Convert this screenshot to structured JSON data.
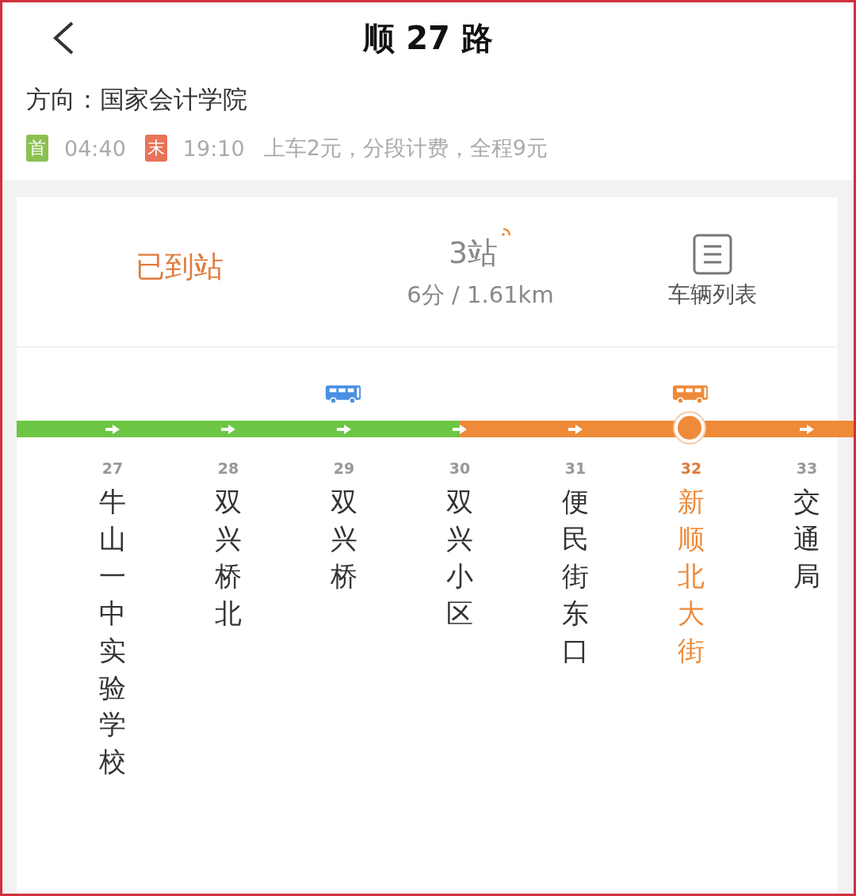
{
  "header": {
    "title": "顺 27 路"
  },
  "route": {
    "direction_label": "方向：",
    "direction": "国家会计学院",
    "first_badge": "首",
    "first_time": "04:40",
    "last_badge": "末",
    "last_time": "19:10",
    "fare": "上车2元，分段计费，全程9元"
  },
  "arrival": {
    "status": "已到站",
    "stops": "3站",
    "live": true,
    "eta": "6分 / 1.61km",
    "vehicle_list": "车辆列表"
  },
  "stations": [
    {
      "number": "27",
      "name": "牛山一中实验学校",
      "selected": false,
      "color": "#6cc644"
    },
    {
      "number": "28",
      "name": "双兴桥北",
      "selected": false,
      "color": "#6cc644"
    },
    {
      "number": "29",
      "name": "双兴桥",
      "selected": false,
      "color": "#6cc644",
      "bus": {
        "color": "#4a90e2"
      }
    },
    {
      "number": "30",
      "name": "双兴小区",
      "selected": false,
      "color": "#ee8a38"
    },
    {
      "number": "31",
      "name": "便民街东口",
      "selected": false,
      "color": "#ee8a38"
    },
    {
      "number": "32",
      "name": "新顺北大街",
      "selected": true,
      "color": "#ee8a38",
      "bus": {
        "color": "#ee8a38"
      }
    },
    {
      "number": "33",
      "name": "交通局",
      "selected": false,
      "color": "#ee8a38"
    }
  ]
}
